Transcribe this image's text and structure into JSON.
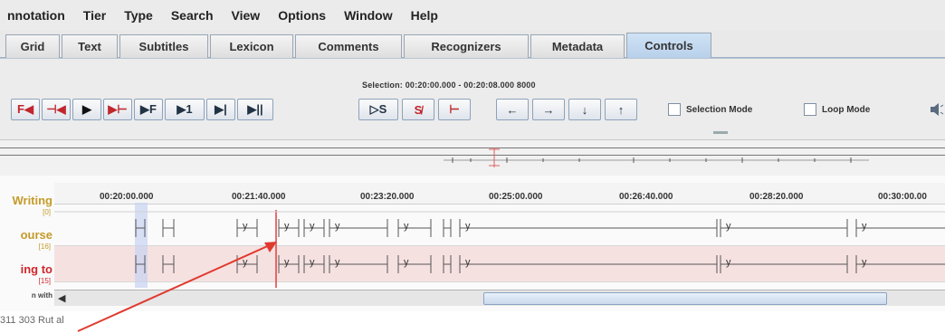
{
  "menu": [
    {
      "label": "nnotation",
      "mnemonic": ""
    },
    {
      "label": "Tier",
      "mnemonic": "T"
    },
    {
      "label": "Type",
      "mnemonic": "y"
    },
    {
      "label": "Search",
      "mnemonic": "S"
    },
    {
      "label": "View",
      "mnemonic": "V"
    },
    {
      "label": "Options",
      "mnemonic": "O"
    },
    {
      "label": "Window",
      "mnemonic": "W"
    },
    {
      "label": "Help",
      "mnemonic": "H"
    }
  ],
  "tabs": [
    {
      "label": "Grid"
    },
    {
      "label": "Text"
    },
    {
      "label": "Subtitles"
    },
    {
      "label": "Lexicon"
    },
    {
      "label": "Comments"
    },
    {
      "label": "Recognizers"
    },
    {
      "label": "Metadata"
    },
    {
      "label": "Controls",
      "active": true
    }
  ],
  "controls": {
    "selection_text": "Selection: 00:20:00.000 - 00:20:08.000 8000",
    "media_buttons": [
      "F◀",
      "⊣◀",
      "▶",
      "▶⊢",
      "▶F",
      "▶1",
      "▶|",
      "▶||"
    ],
    "selection_buttons": [
      "▷S",
      "S̸",
      "⊢"
    ],
    "nav_buttons": [
      "←",
      "→",
      "↓",
      "↑"
    ],
    "selection_mode_label": "Selection Mode",
    "loop_mode_label": "Loop Mode",
    "volume_icon": "speaker-icon"
  },
  "ruler": {
    "labels": [
      "00:20:00.000",
      "00:21:40.000",
      "00:23:20.000",
      "00:25:00.000",
      "00:26:40.000",
      "00:28:20.000",
      "00:30:00.00"
    ]
  },
  "tiers": [
    {
      "name": "Writing",
      "count": "[0]",
      "color": "#c49b2a"
    },
    {
      "name": "ourse",
      "count": "[16]",
      "color": "#c49b2a"
    },
    {
      "name": "ing to",
      "count": "[15]",
      "color": "#d0262c"
    },
    {
      "name": "n with",
      "count": "",
      "color": "#444444"
    }
  ],
  "annotation_value": "y",
  "bottom_text": "311 303 Rut al",
  "colors": {
    "accent": "#b8d0ea",
    "crosshair": "#e04040",
    "arrow": "#e03a2f",
    "active_tier_bg": "#f6e1e1"
  }
}
